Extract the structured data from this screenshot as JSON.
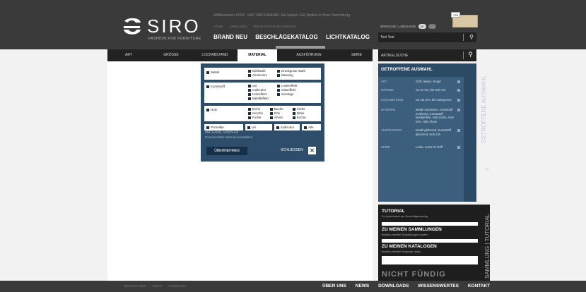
{
  "header": {
    "logo_word": "SIRO",
    "logo_tagline": "FASHION FOR FURNITURE",
    "welcome": "Willkommen VOR- UND NACHNAME! Sie haben 126 Artikel in Ihrer Sammlung.",
    "top_links": [
      "HOME",
      "ABMELDEN",
      "MEINE DATEN BEARBEITEN"
    ],
    "nav": [
      "BRAND NEU",
      "BESCHLÄGEKATALOG",
      "LICHTKATALOG"
    ],
    "language_label": "SPRACHE | LANGUAGE",
    "lang_de": "DE",
    "lang_en": "EN",
    "cart_count": "126",
    "user_search_value": "Test Test"
  },
  "filterbar": {
    "tabs": [
      "ART",
      "GRÖSSE",
      "LOCHABSTAND",
      "MATERIAL",
      "AUSFÜHRUNG",
      "SERIE"
    ],
    "active_tab": "MATERIAL",
    "article_search_label": "ARTIKELSUCHE"
  },
  "material": {
    "metall": {
      "label": "Metall",
      "options": [
        "Edelstahl",
        "Aluminium",
        "Druckguss/ Stahl",
        "Messing"
      ]
    },
    "kunststoff": {
      "label": "Kunststoff",
      "options": [
        "uni",
        "multicolor",
        "Holzeffekt",
        "Metalleffekt",
        "Ledereffekt",
        "Glaseffekt",
        "Sonstige"
      ]
    },
    "holz": {
      "label": "Holz",
      "options": [
        "Eiche",
        "Kirsche",
        "Fichte",
        "Buche",
        "Erle",
        "Ahorn",
        "Kiefer",
        "Birke",
        "Esche"
      ]
    },
    "porzellan": {
      "label": "Porzellan",
      "options": [
        "uni",
        "multicolor",
        "Alle"
      ]
    },
    "title": "MATERIAL WÄHLEN",
    "subtitle": "Gewünschtes Material auswählen",
    "apply_label": "ÜBERNEHMEN",
    "close_label": "SCHLIESSEN"
  },
  "selection": {
    "title": "GETROFFENE AUSWAHL",
    "vertical_tab": "GETROFFENE AUSWAHL",
    "rows": [
      {
        "key": "ART",
        "value": "Griff, Haken, Knopf"
      },
      {
        "key": "GRÖSSE",
        "value": "von 0 mm, bis 200 mm"
      },
      {
        "key": "LOCHABSTAND",
        "value": "von 32 mm, bis unbegrenzt"
      },
      {
        "key": "MATERIAL",
        "value": "Metall Aluminium, Kunststoff multicolor, Kunststoff Metalleffekt, Holz Eiche, Holz Erle, Holz Ahorn"
      },
      {
        "key": "AUSFÜHRUNG",
        "value": "Metall glänzend, Kunststoff glänzend, Holz roh"
      },
      {
        "key": "SERIE",
        "value": "Leder, Kunst im Griff"
      }
    ]
  },
  "tutorial": {
    "items": [
      {
        "title": "TUTORIAL",
        "sub": "So funktioniert der Beschlägekatalog"
      },
      {
        "title": "ZU MEINEN SAMMLUNGEN",
        "sub": "Bereits erstellte Sammlungen starten"
      },
      {
        "title": "ZU MEINEN KATALOGEN",
        "sub": "Bereits erstellte Kataloge laden"
      }
    ],
    "nicht_label": "NICHT FÜNDIG",
    "vertical_tab": "SAMMLUNG | TUTORIAL"
  },
  "footer": {
    "left_links": [
      "NEWSLETTER",
      "VIDEO",
      "FACEBOOK"
    ],
    "right_links": [
      "ÜBER UNS",
      "NEWS",
      "DOWNLOADS",
      "WISSENSWERTES",
      "KONTAKT"
    ]
  },
  "colors": {
    "header_bg": "#3a3a3a",
    "panel_blue": "#2d4d6a",
    "page_bg": "#f2f2f2"
  }
}
